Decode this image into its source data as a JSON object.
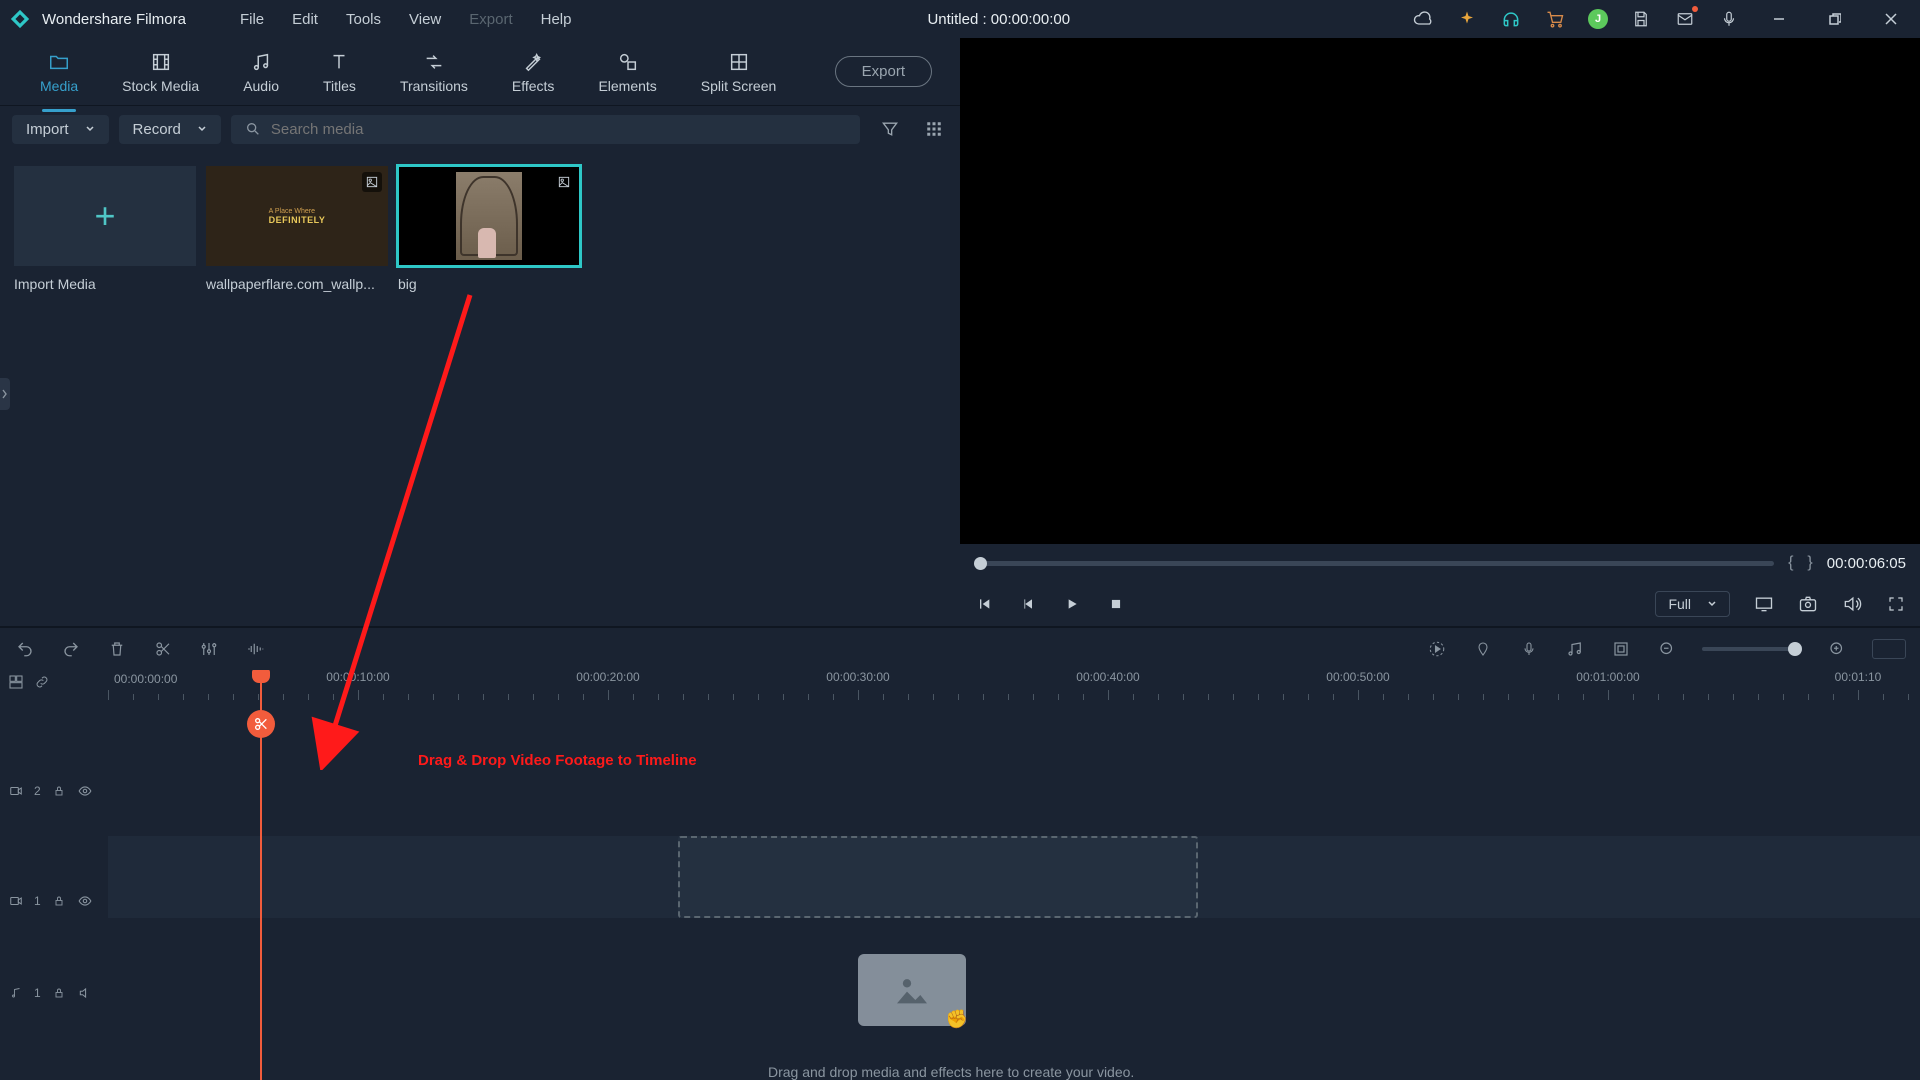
{
  "app": {
    "name": "Wondershare Filmora",
    "title_center": "Untitled : 00:00:00:00"
  },
  "menus": {
    "file": "File",
    "edit": "Edit",
    "tools": "Tools",
    "view": "View",
    "export": "Export",
    "help": "Help"
  },
  "tabs": {
    "media": "Media",
    "stock": "Stock Media",
    "audio": "Audio",
    "titles": "Titles",
    "transitions": "Transitions",
    "effects": "Effects",
    "elements": "Elements",
    "split": "Split Screen",
    "export_btn": "Export"
  },
  "subbar": {
    "import": "Import",
    "record": "Record",
    "search_ph": "Search media"
  },
  "media": {
    "import_media": "Import Media",
    "item1": "wallpaperflare.com_wallp...",
    "item1_badge_top": "A Place Where",
    "item1_badge": "DEFINITELY",
    "item2": "big"
  },
  "preview": {
    "tc": "00:00:06:05",
    "quality": "Full"
  },
  "timeline": {
    "start": "00:00:00:00",
    "marks": [
      "00:00:10:00",
      "00:00:20:00",
      "00:00:30:00",
      "00:00:40:00",
      "00:00:50:00",
      "00:01:00:00",
      "00:01:10"
    ],
    "track2": "2",
    "track1": "1",
    "audio1": "1",
    "hint": "Drag and drop media and effects here to create your video."
  },
  "annotation": {
    "label": "Drag & Drop Video Footage to Timeline"
  },
  "avatar_initial": "J"
}
